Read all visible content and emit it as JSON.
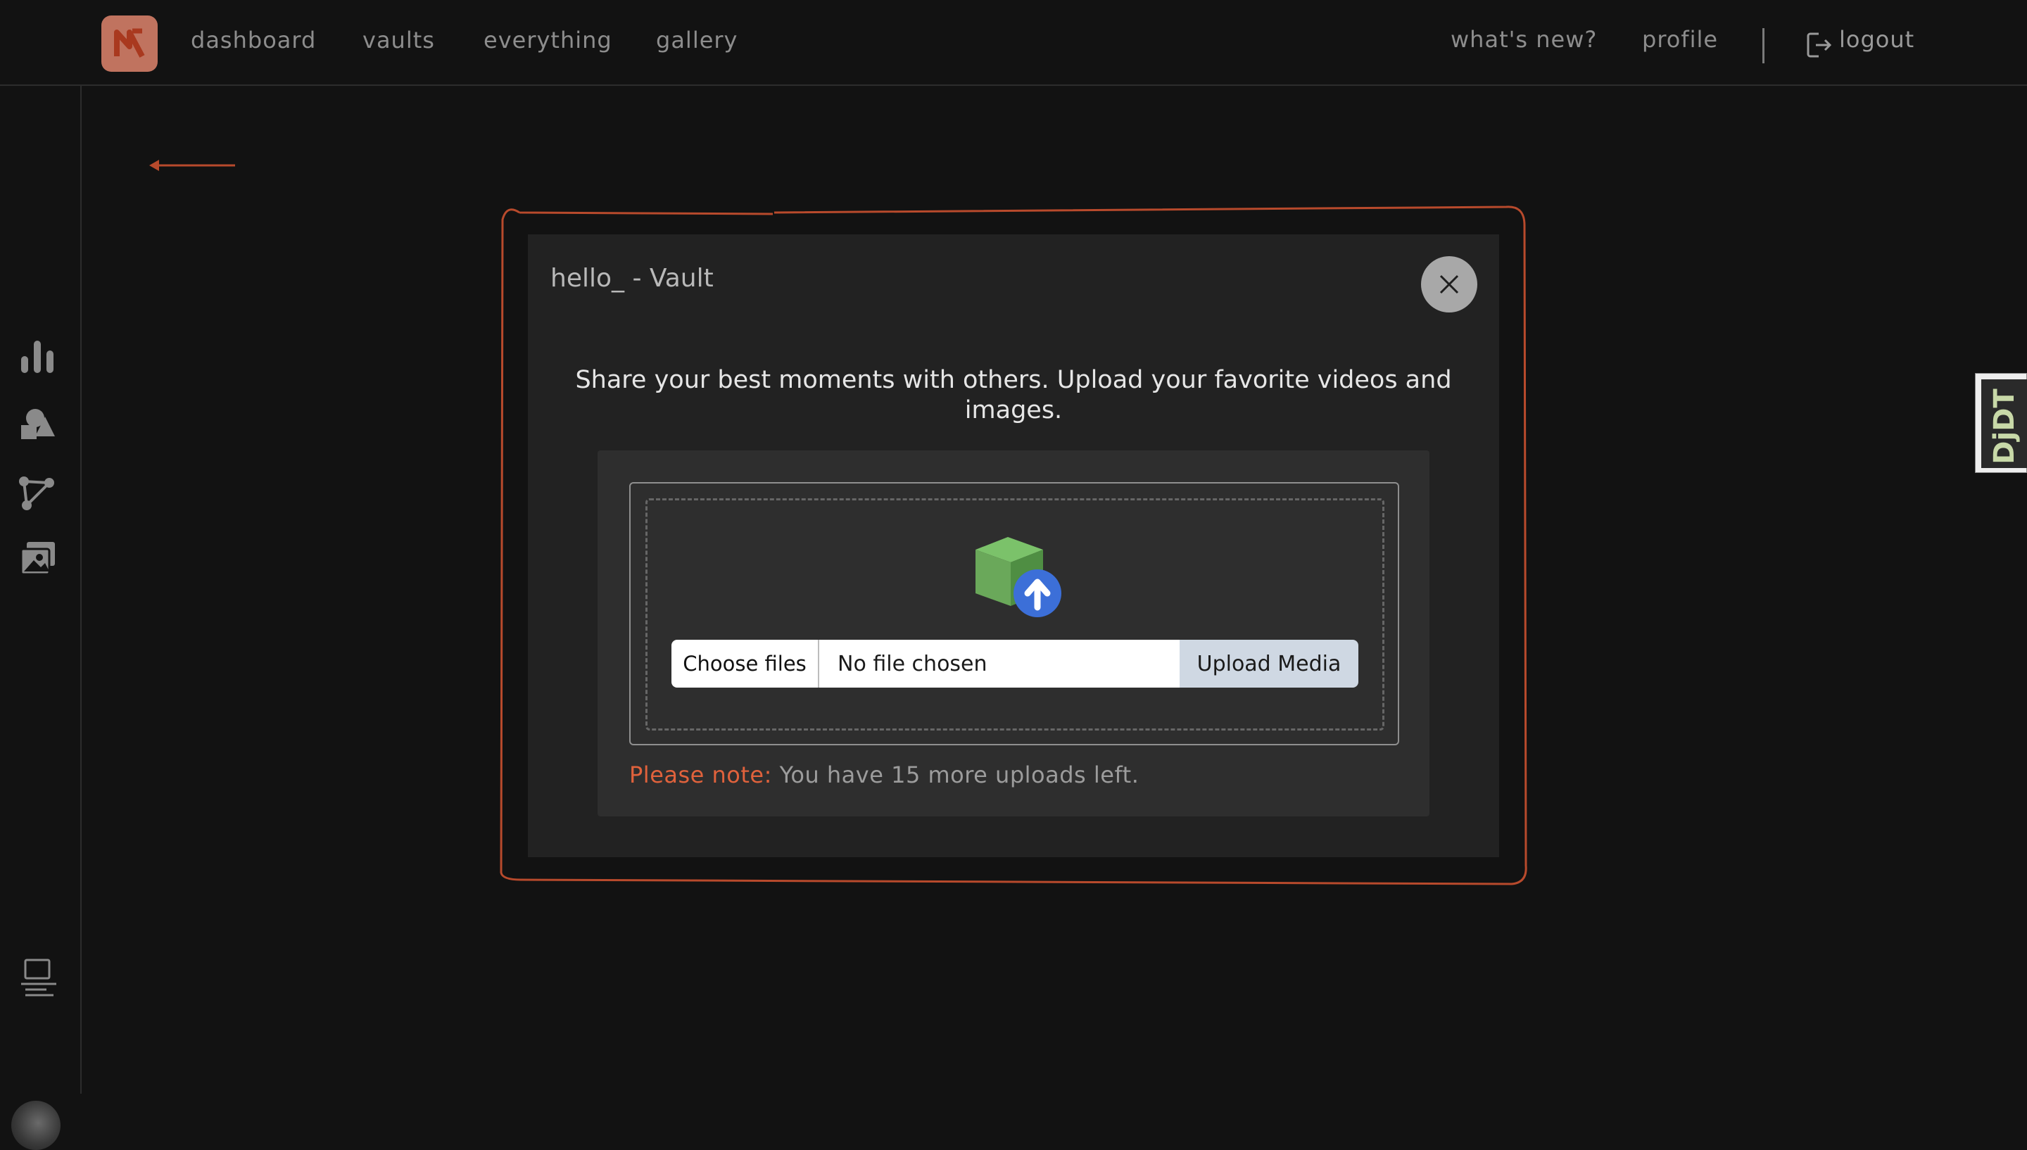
{
  "nav": {
    "links": [
      "dashboard",
      "vaults",
      "everything",
      "gallery"
    ],
    "right_links": [
      "what's new?",
      "profile"
    ],
    "logout_label": "logout"
  },
  "sidebar": {
    "icons": [
      "bar-chart-icon",
      "shapes-icon",
      "nodes-icon",
      "images-icon",
      "laptop-icon"
    ]
  },
  "modal": {
    "title": "hello_ - Vault",
    "description": "Share your best moments with others. Upload your favorite videos and images.",
    "choose_label": "Choose files",
    "file_status": "No file chosen",
    "upload_label": "Upload Media",
    "note_label": "Please note:",
    "note_text": " You have 15 more uploads left."
  },
  "debug_toolbar": {
    "label": "DjDT"
  },
  "colors": {
    "accent": "#e0623c",
    "logo": "#c0735f",
    "background": "#121212",
    "modal_bg": "#222222",
    "upload_button": "#cfd8e3"
  }
}
